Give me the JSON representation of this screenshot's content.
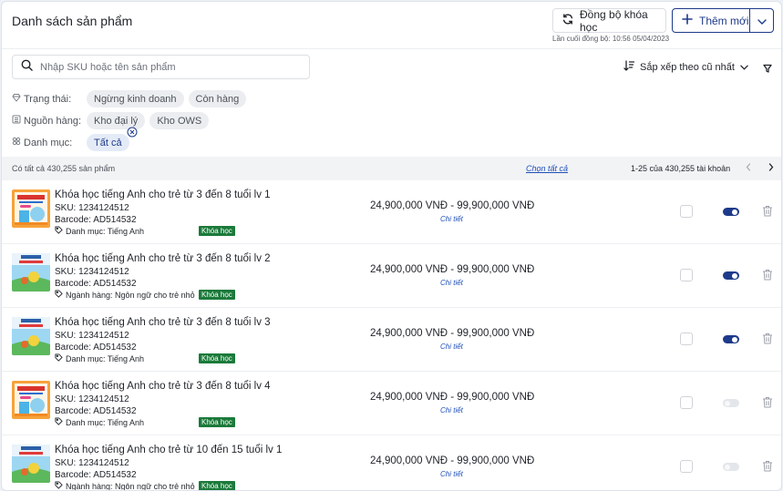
{
  "header": {
    "title": "Danh sách sản phẩm",
    "sync_label": "Đồng bộ khóa học",
    "sync_caption": "Lần cuối đồng bộ: 10:56 05/04/2023",
    "add_label": "Thêm mới"
  },
  "search": {
    "placeholder": "Nhập SKU hoặc tên sản phẩm"
  },
  "sort": {
    "label": "Sắp xếp theo cũ nhất"
  },
  "filters": {
    "status": {
      "label": "Trạng thái:",
      "chips": [
        "Ngừng kinh doanh",
        "Còn hàng"
      ]
    },
    "source": {
      "label": "Nguồn hàng:",
      "chips": [
        "Kho đại lý",
        "Kho OWS"
      ]
    },
    "category": {
      "label": "Danh mục:",
      "chips": [
        "Tất cả"
      ]
    }
  },
  "summary": {
    "count": "Có tất cả 430,255 sản phẩm",
    "select_all": "Chọn tất cả",
    "page_info": "1-25 của 430,255 tài khoản"
  },
  "accent_color": "#1e3a8a",
  "badge_color": "#1b7a3a",
  "products": [
    {
      "name": "Khóa học tiếng Anh cho trẻ từ 3 đến 8 tuổi lv 1",
      "sku": "SKU: 1234124512",
      "barcode": "Barcode: AD514532",
      "category": "Danh mục: Tiếng Anh",
      "badge": "Khóa học",
      "price": "24,900,000 VNĐ - 99,900,000 VNĐ",
      "detail": "Chi tiết",
      "active": true,
      "thumb": "orange"
    },
    {
      "name": "Khóa học tiếng Anh cho trẻ từ 3 đến 8 tuổi lv 2",
      "sku": "SKU: 1234124512",
      "barcode": "Barcode: AD514532",
      "category": "Ngành hàng: Ngôn ngữ cho trẻ nhỏ",
      "badge": "Khóa học",
      "price": "24,900,000 VNĐ - 99,900,000 VNĐ",
      "detail": "Chi tiết",
      "active": true,
      "thumb": "green"
    },
    {
      "name": "Khóa học tiếng Anh cho trẻ từ 3 đến 8 tuổi lv 3",
      "sku": "SKU: 1234124512",
      "barcode": "Barcode: AD514532",
      "category": "Danh mục: Tiếng Anh",
      "badge": "Khóa học",
      "price": "24,900,000 VNĐ - 99,900,000 VNĐ",
      "detail": "Chi tiết",
      "active": true,
      "thumb": "green"
    },
    {
      "name": "Khóa học tiếng Anh cho trẻ từ 3 đến 8 tuổi  lv 4",
      "sku": "SKU: 1234124512",
      "barcode": "Barcode: AD514532",
      "category": "Danh mục: Tiếng Anh",
      "badge": "Khóa học",
      "price": "24,900,000 VNĐ - 99,900,000 VNĐ",
      "detail": "Chi tiết",
      "active": false,
      "thumb": "orange"
    },
    {
      "name": "Khóa học tiếng Anh cho trẻ từ 10 đến 15 tuổi  lv 1",
      "sku": "SKU: 1234124512",
      "barcode": "Barcode: AD514532",
      "category": "Ngành hàng: Ngôn ngữ cho trẻ nhỏ",
      "badge": "Khóa học",
      "price": "24,900,000 VNĐ - 99,900,000 VNĐ",
      "detail": "Chi tiết",
      "active": false,
      "thumb": "green"
    }
  ]
}
